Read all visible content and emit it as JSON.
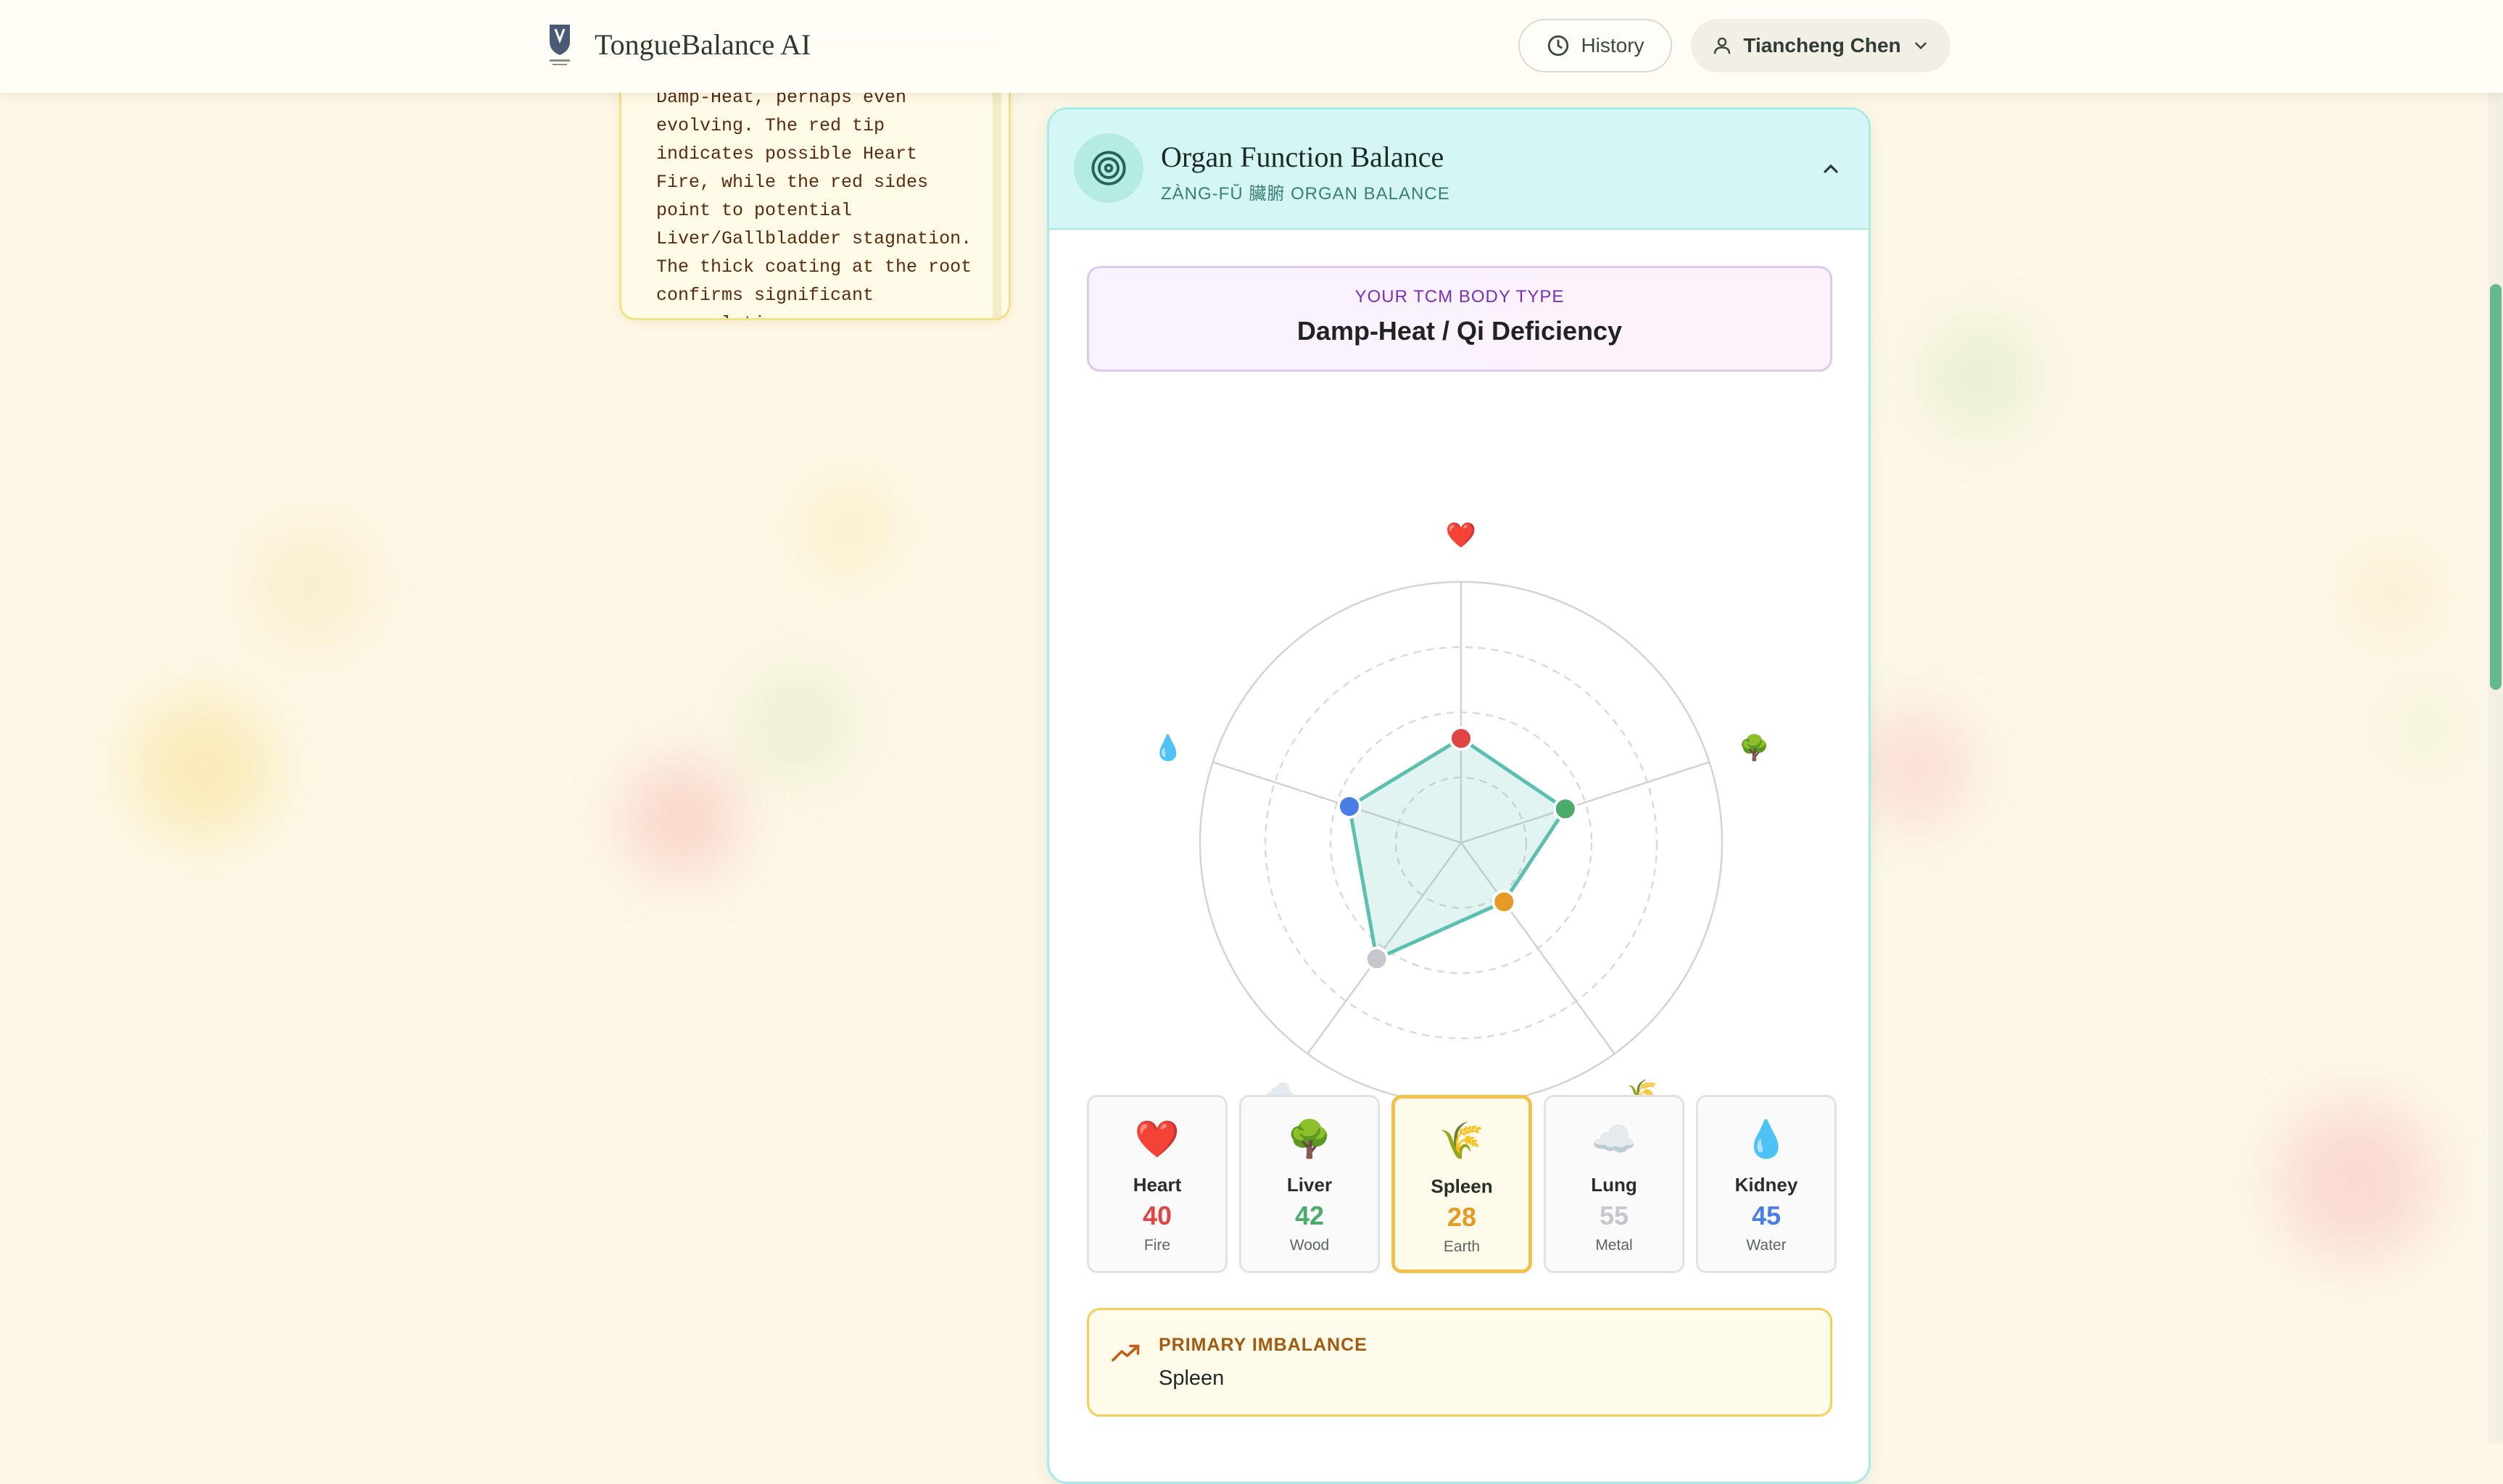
{
  "header": {
    "brand": "TongueBalance AI",
    "history_label": "History",
    "user_name": "Tiancheng Chen"
  },
  "note": {
    "text": "Damp-Heat, perhaps even\nevolving. The red tip\nindicates possible Heart\nFire, while the red sides\npoint to potential\nLiver/Gallbladder stagnation.\nThe thick coating at the root\nconfirms significant\naccumulation"
  },
  "panel": {
    "title": "Organ Function Balance",
    "subtitle": "ZÀNG-FŬ 臟腑 ORGAN BALANCE",
    "body_type_label": "YOUR TCM BODY TYPE",
    "body_type_value": "Damp-Heat / Qi Deficiency",
    "imbalance_label": "PRIMARY IMBALANCE",
    "imbalance_value": "Spleen"
  },
  "organs": [
    {
      "name": "Heart",
      "score": "40",
      "value": 40,
      "element": "Fire",
      "emoji": "❤️",
      "color": "#e04444"
    },
    {
      "name": "Liver",
      "score": "42",
      "value": 42,
      "element": "Wood",
      "emoji": "🌳",
      "color": "#4aab6a"
    },
    {
      "name": "Spleen",
      "score": "28",
      "value": 28,
      "element": "Earth",
      "emoji": "🌾",
      "color": "#e59a26"
    },
    {
      "name": "Lung",
      "score": "55",
      "value": 55,
      "element": "Metal",
      "emoji": "☁️",
      "color": "#c4c7cc"
    },
    {
      "name": "Kidney",
      "score": "45",
      "value": 45,
      "element": "Water",
      "emoji": "💧",
      "color": "#4a7ee6"
    }
  ],
  "radar": {
    "max": 100,
    "fill": "#5cc0b0",
    "stroke": "#5cc0b0"
  },
  "selected_organ": "Spleen"
}
